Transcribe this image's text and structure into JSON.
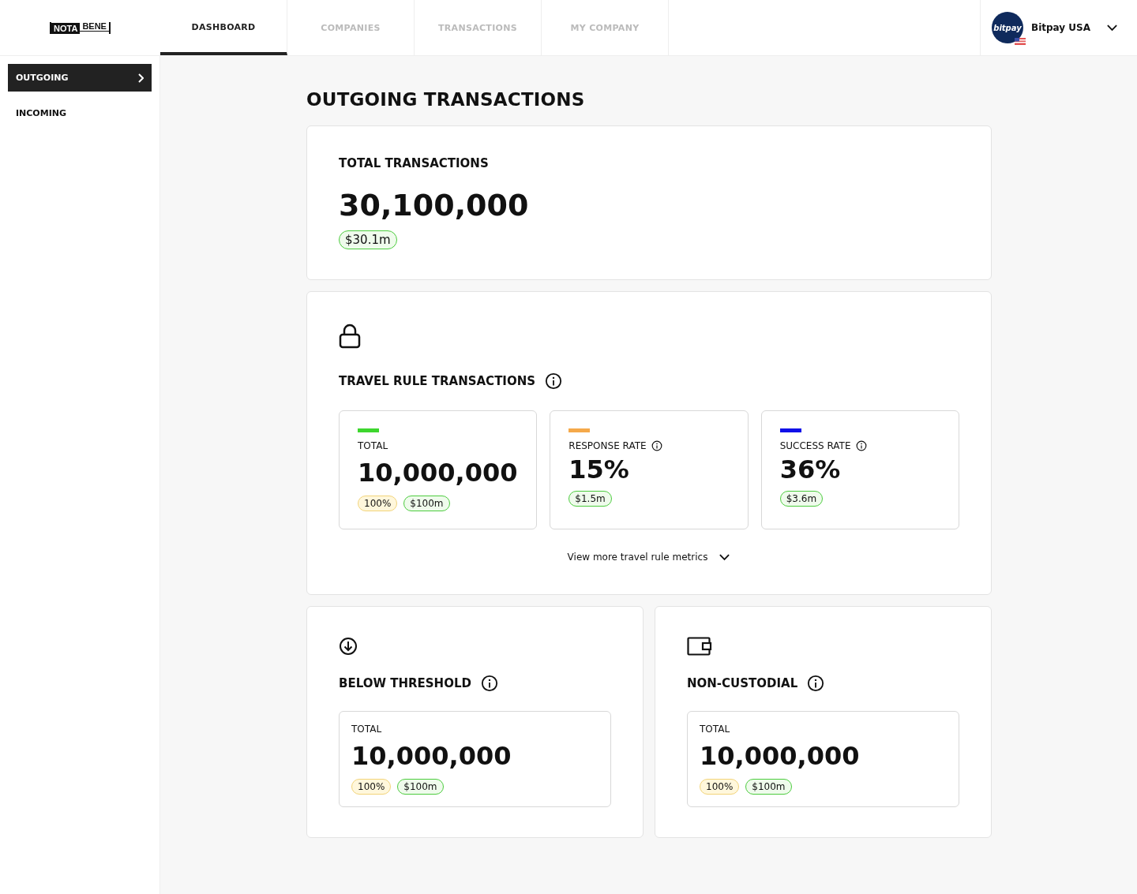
{
  "logo": {
    "left": "NOTA",
    "right": "BENE"
  },
  "tabs": [
    {
      "label": "DASHBOARD",
      "selected": true
    },
    {
      "label": "COMPANIES",
      "selected": false
    },
    {
      "label": "TRANSACTIONS",
      "selected": false
    },
    {
      "label": "MY COMPANY",
      "selected": false
    }
  ],
  "account": {
    "avatar": "bitpay",
    "name": "Bitpay USA"
  },
  "sidebar": {
    "items": [
      {
        "label": "OUTGOING",
        "selected": true
      },
      {
        "label": "INCOMING",
        "selected": false
      }
    ]
  },
  "page_title": "OUTGOING TRANSACTIONS",
  "total_card": {
    "title": "TOTAL TRANSACTIONS",
    "value": "30,100,000",
    "badges": [
      {
        "kind": "amount",
        "text": "$30.1m"
      }
    ]
  },
  "travel_rule": {
    "title": "TRAVEL RULE TRANSACTIONS",
    "metrics": [
      {
        "label": "TOTAL",
        "info": false,
        "color": "#3ed62e",
        "value": "10,000,000",
        "badges": [
          {
            "kind": "share",
            "text": "100%"
          },
          {
            "kind": "amount",
            "text": "$100m"
          }
        ]
      },
      {
        "label": "RESPONSE RATE",
        "info": true,
        "color": "#f5a94a",
        "value": "15%",
        "badges": [
          {
            "kind": "amount",
            "text": "$1.5m"
          }
        ]
      },
      {
        "label": "SUCCESS RATE",
        "info": true,
        "color": "#1010e8",
        "value": "36%",
        "badges": [
          {
            "kind": "amount",
            "text": "$3.6m"
          }
        ]
      }
    ],
    "more_link": "View more travel rule metrics"
  },
  "panels": [
    {
      "kind": "arrow",
      "title": "BELOW THRESHOLD",
      "label": "TOTAL",
      "value": "10,000,000",
      "badges": [
        {
          "kind": "share",
          "text": "100%"
        },
        {
          "kind": "amount",
          "text": "$100m"
        }
      ]
    },
    {
      "kind": "wallet",
      "title": "NON-CUSTODIAL",
      "label": "TOTAL",
      "value": "10,000,000",
      "badges": [
        {
          "kind": "share",
          "text": "100%"
        },
        {
          "kind": "amount",
          "text": "$100m"
        }
      ]
    }
  ]
}
